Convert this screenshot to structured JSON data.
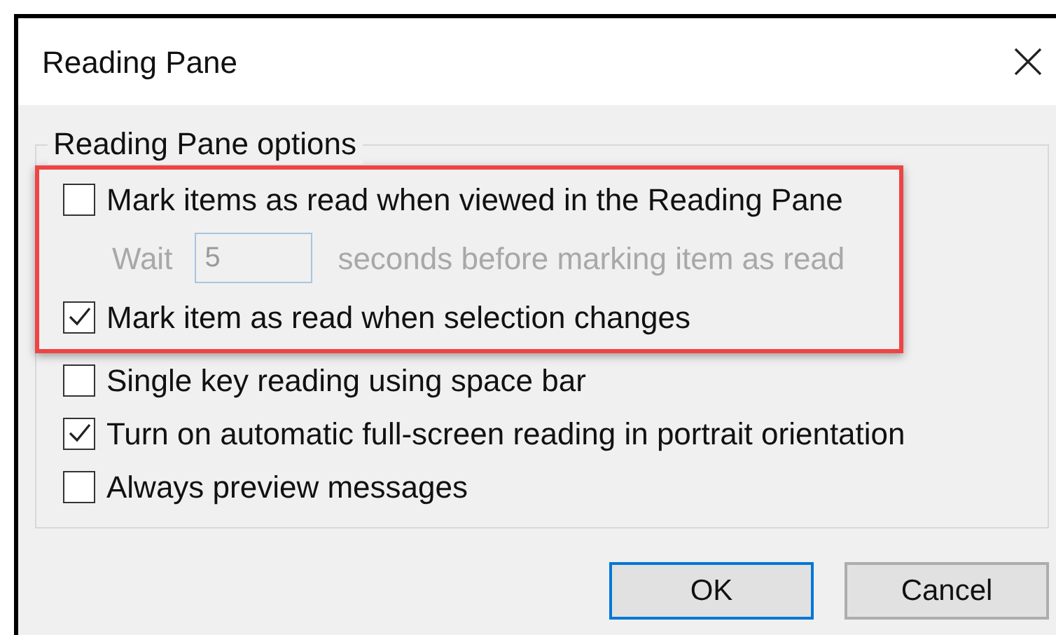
{
  "window": {
    "title": "Reading Pane"
  },
  "group": {
    "label": "Reading Pane options"
  },
  "options": [
    {
      "kind": "checkbox",
      "label": "Mark items as read when viewed in the Reading Pane",
      "checked": false,
      "highlighted": true
    },
    {
      "kind": "wait",
      "label": "Wait",
      "value": "5",
      "suffix": "seconds before marking item as read",
      "disabled": true,
      "highlighted": true
    },
    {
      "kind": "checkbox",
      "label": "Mark item as read when selection changes",
      "checked": true,
      "highlighted": true
    },
    {
      "kind": "checkbox",
      "label": "Single key reading using space bar",
      "checked": false,
      "highlighted": false
    },
    {
      "kind": "checkbox",
      "label": "Turn on automatic full-screen reading in portrait orientation",
      "checked": true,
      "highlighted": false
    },
    {
      "kind": "checkbox",
      "label": "Always preview messages",
      "checked": false,
      "highlighted": false
    }
  ],
  "buttons": [
    {
      "label": "OK",
      "default": true
    },
    {
      "label": "Cancel",
      "default": false
    }
  ]
}
